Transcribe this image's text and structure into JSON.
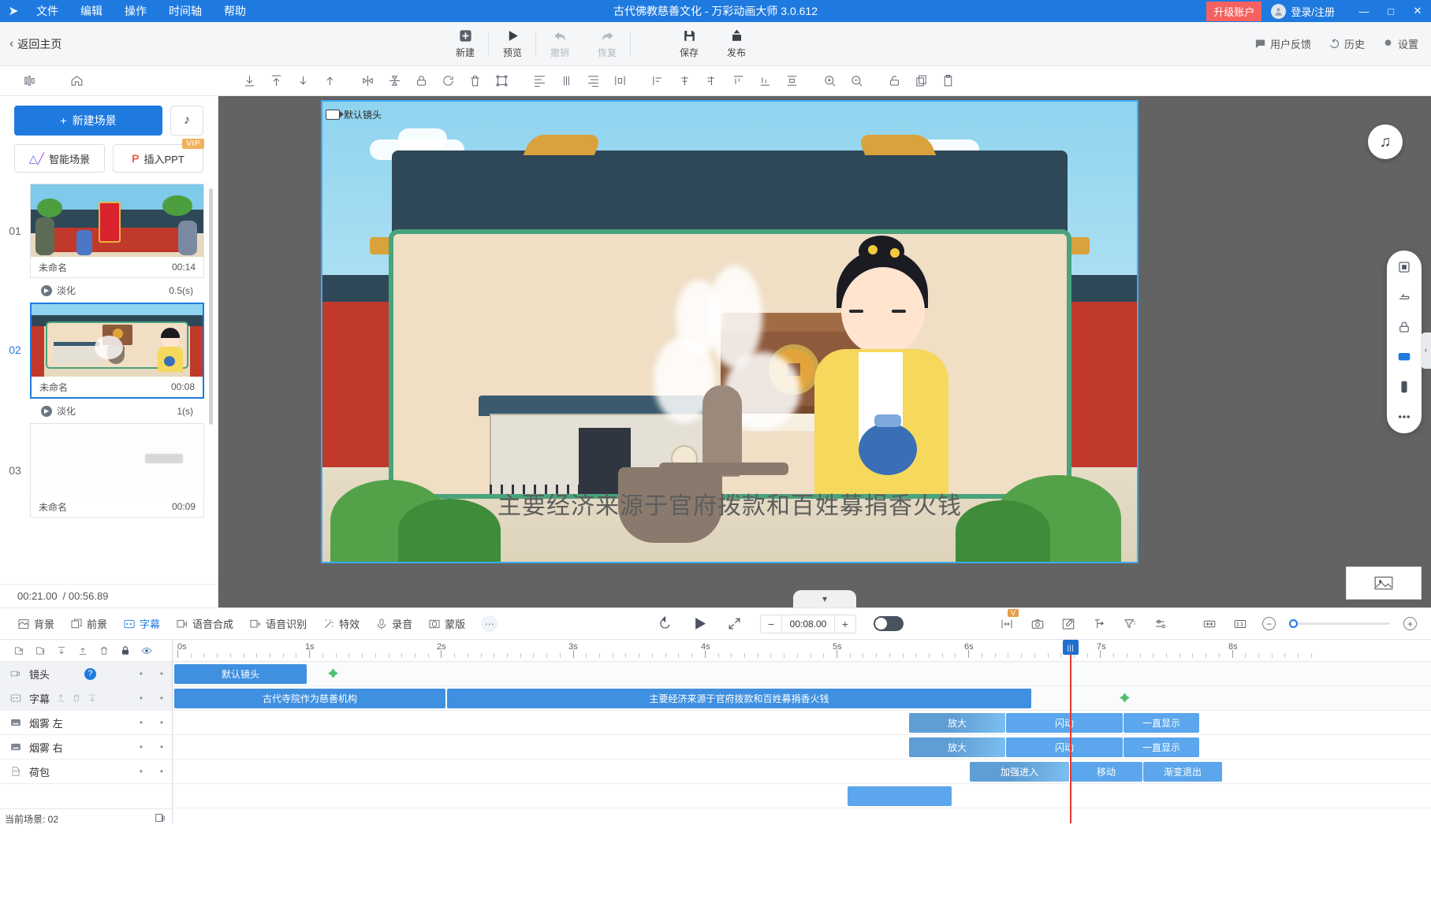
{
  "titlebar": {
    "logo": "logo-icon",
    "menus": [
      "文件",
      "编辑",
      "操作",
      "时间轴",
      "帮助"
    ],
    "title": "古代佛教慈善文化 - 万彩动画大师 3.0.612",
    "upgrade_label": "升级账户",
    "login_label": "登录/注册",
    "minimize": "—",
    "maximize": "□",
    "close": "✕",
    "accent_color": "#1f7ae0",
    "upgrade_color": "#f4615f"
  },
  "toolbar": {
    "back_home": "返回主页",
    "buttons": [
      {
        "label": "新建",
        "icon": "plus-square-icon",
        "enabled": true
      },
      {
        "label": "预览",
        "icon": "play-icon",
        "enabled": true
      },
      {
        "label": "撤销",
        "icon": "undo-icon",
        "enabled": false
      },
      {
        "label": "恢复",
        "icon": "redo-icon",
        "enabled": false
      },
      {
        "label": "保存",
        "icon": "save-icon",
        "enabled": true
      },
      {
        "label": "发布",
        "icon": "publish-icon",
        "enabled": true
      }
    ],
    "right_items": [
      {
        "label": "用户反馈",
        "icon": "feedback-icon"
      },
      {
        "label": "历史",
        "icon": "history-icon"
      },
      {
        "label": "设置",
        "icon": "gear-icon"
      }
    ]
  },
  "iconstrip": {
    "left": [
      "layers-icon",
      "home-icon"
    ],
    "main": [
      "align-bottom-icon",
      "align-top-icon",
      "move-down-icon",
      "move-up-icon",
      "flip-horizontal-icon",
      "flip-vertical-icon",
      "lock-icon",
      "rotate-icon",
      "trash-icon",
      "group-icon",
      "align-left-icon",
      "align-center-icon",
      "align-right-icon",
      "distribute-icon",
      "align-hleft-icon",
      "align-hcenter-icon",
      "align-hright-icon",
      "align-top2-icon",
      "align-bottom2-icon",
      "distribute-v-icon",
      "zoom-in-icon",
      "zoom-out-icon",
      "unlock-icon",
      "copy-icon",
      "paste-icon"
    ]
  },
  "scenes_panel": {
    "new_scene_label": "新建场景",
    "music_icon": "music-note-icon",
    "smart_scene_label": "智能场景",
    "insert_ppt_label": "插入PPT",
    "vip_badge": "VIP",
    "scenes": [
      {
        "num": "01",
        "name": "未命名",
        "duration": "00:14",
        "selected": false
      },
      {
        "num": "02",
        "name": "未命名",
        "duration": "00:08",
        "selected": true
      },
      {
        "num": "03",
        "name": "未命名",
        "duration": "00:09",
        "selected": false
      }
    ],
    "transitions": [
      {
        "name": "淡化",
        "duration": "0.5(s)"
      },
      {
        "name": "淡化",
        "duration": "1(s)"
      }
    ],
    "current_time": "00:21.00",
    "total_time": "/ 00:56.89"
  },
  "canvas": {
    "camera_label": "默认镜头",
    "subtitle": "主要经济来源于官府拨款和百姓募捐香火钱",
    "music_button": "music-note-icon",
    "collapse_icon": "chevron-down-icon",
    "right_tools": [
      "fit-screen-icon",
      "pan-icon",
      "lock-icon",
      "display-icon",
      "mobile-icon",
      "more-icon"
    ]
  },
  "bottom_toolbar": {
    "items": [
      {
        "label": "背景",
        "icon": "background-icon",
        "active": false
      },
      {
        "label": "前景",
        "icon": "foreground-icon",
        "active": false
      },
      {
        "label": "字幕",
        "icon": "subtitle-cc-icon",
        "active": true
      },
      {
        "label": "语音合成",
        "icon": "tts-icon",
        "active": false
      },
      {
        "label": "语音识别",
        "icon": "asr-icon",
        "active": false
      },
      {
        "label": "特效",
        "icon": "effects-icon",
        "active": false
      },
      {
        "label": "录音",
        "icon": "microphone-icon",
        "active": false
      },
      {
        "label": "蒙版",
        "icon": "mask-icon",
        "active": false
      }
    ],
    "more_icon": "more-dots-icon",
    "playback": {
      "replay_icon": "replay-icon",
      "play_icon": "play-icon",
      "fullscreen_icon": "expand-icon",
      "minus": "−",
      "duration": "00:08.00",
      "plus": "+",
      "toggle_on": true
    },
    "right_icons": [
      {
        "name": "fit-width-icon",
        "badge": "V"
      },
      {
        "name": "camera-icon",
        "badge": ""
      },
      {
        "name": "edit-icon",
        "badge": ""
      },
      {
        "name": "pin-icon",
        "badge": ""
      },
      {
        "name": "filter-icon",
        "badge": ""
      },
      {
        "name": "settings-sliders-icon",
        "badge": ""
      },
      {
        "name": "fit-horizontal-icon",
        "badge": ""
      },
      {
        "name": "scale-1-1-icon",
        "badge": ""
      }
    ],
    "zoom_out": "−",
    "zoom_in": "+"
  },
  "timeline": {
    "header_icons": [
      "import-icon",
      "add-folder-icon",
      "move-down-icon",
      "move-up-icon",
      "trash-icon",
      "lock-icon",
      "eye-icon"
    ],
    "ruler_labels": [
      "0s",
      "1s",
      "2s",
      "3s",
      "4s",
      "5s",
      "6s",
      "7s",
      "8s"
    ],
    "tracks": [
      {
        "name": "镜头",
        "icon": "camera-track-icon",
        "has_help": true,
        "highlighted": true,
        "clips": [
          {
            "label": "默认镜头",
            "start": 0.0,
            "end": 1.45,
            "style": "solid"
          }
        ],
        "markers": [
          1.63
        ]
      },
      {
        "name": "字幕",
        "icon": "cc-track-icon",
        "has_tools": true,
        "highlighted": true,
        "clips": [
          {
            "label": "古代寺院作为慈善机构",
            "start": 0.0,
            "end": 3.05,
            "style": "solid"
          },
          {
            "label": "主要经济来源于官府拨款和百姓募捐香火钱",
            "start": 3.08,
            "end": 7.48,
            "style": "solid"
          }
        ],
        "markers": [
          7.72
        ]
      },
      {
        "name": "烟雾 左",
        "icon": "image-track-icon",
        "clips": [
          {
            "label": "放大",
            "start": 5.85,
            "end": 6.97,
            "style": "grad"
          },
          {
            "label": "闪动",
            "start": 6.98,
            "end": 8.28,
            "style": "light"
          },
          {
            "label": "一直显示",
            "start": 8.3,
            "end": 8.9,
            "style": "light"
          }
        ]
      },
      {
        "name": "烟雾 右",
        "icon": "image-track-icon",
        "clips": [
          {
            "label": "放大",
            "start": 5.85,
            "end": 6.97,
            "style": "grad"
          },
          {
            "label": "闪动",
            "start": 6.98,
            "end": 8.28,
            "style": "light"
          },
          {
            "label": "一直显示",
            "start": 8.3,
            "end": 8.9,
            "style": "light"
          }
        ]
      },
      {
        "name": "荷包",
        "icon": "svg-track-icon",
        "clips": [
          {
            "label": "加强进入",
            "start": 6.3,
            "end": 7.45,
            "style": "grad"
          },
          {
            "label": "移动",
            "start": 7.47,
            "end": 8.28,
            "style": "light"
          },
          {
            "label": "渐变退出",
            "start": 8.3,
            "end": 8.95,
            "style": "light"
          }
        ]
      }
    ],
    "playhead_time": 6.77,
    "status": "当前场景: 02",
    "status_icon": "scene-icon"
  }
}
